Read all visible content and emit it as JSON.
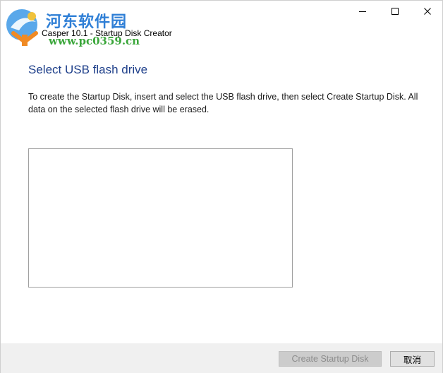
{
  "window": {
    "title": "Casper 10.1 - Startup Disk Creator",
    "controls": {
      "minimize_icon": "minimize-icon",
      "maximize_icon": "maximize-icon",
      "close_icon": "close-icon"
    }
  },
  "watermark": {
    "site_name": "河东软件园",
    "url": "www.pc0359.cn",
    "colors": {
      "name": "#2f7fd6",
      "url": "#3aa63a"
    }
  },
  "page": {
    "heading": "Select USB flash drive",
    "description": "To create the Startup Disk, insert and select the USB flash drive, then select Create Startup Disk. All data on the selected flash drive will be erased.",
    "drive_list_items": []
  },
  "footer": {
    "create_label": "Create Startup Disk",
    "create_enabled": false,
    "cancel_label": "取消"
  },
  "colors": {
    "heading": "#1e3f8a",
    "footer_bg": "#f0f0f0"
  }
}
